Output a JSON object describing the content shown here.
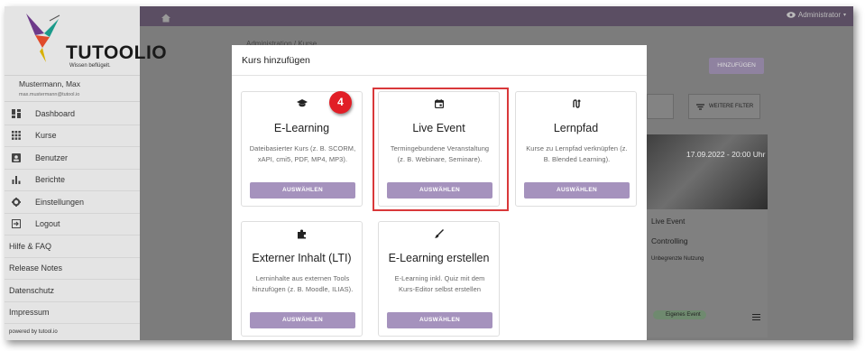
{
  "app": {
    "logo_text": "TUTOOLIO",
    "logo_tagline": "Wissen beflügelt."
  },
  "user": {
    "name": "Mustermann, Max",
    "email": "max.mustermann@tutool.io"
  },
  "sidebar": {
    "items": [
      {
        "label": "Dashboard",
        "icon": "dashboard-icon"
      },
      {
        "label": "Kurse",
        "icon": "grid-icon"
      },
      {
        "label": "Benutzer",
        "icon": "user-icon"
      },
      {
        "label": "Berichte",
        "icon": "bar-chart-icon"
      },
      {
        "label": "Einstellungen",
        "icon": "gear-icon"
      },
      {
        "label": "Logout",
        "icon": "logout-icon"
      }
    ],
    "links": [
      "Hilfe & FAQ",
      "Release Notes",
      "Datenschutz",
      "Impressum"
    ],
    "powered_by": "powered by tutool.io"
  },
  "topbar": {
    "home_icon": "home-icon",
    "admin_label": "Administrator"
  },
  "background": {
    "breadcrumb": "Administration / Kurse",
    "add_button": "HINZUFÜGEN",
    "filter_button": "WEITERE FILTER",
    "course_date": "17.09.2022 - 20:00 Uhr",
    "course_kind": "Live Event",
    "course_title": "Controlling",
    "course_usage": "Unbegrenzte Nutzung",
    "course_badge": "Eigenes Event"
  },
  "modal": {
    "title": "Kurs hinzufügen",
    "cards": [
      {
        "title": "E-Learning",
        "description": "Dateibasierter Kurs (z. B. SCORM, xAPI, cmi5, PDF, MP4, MP3).",
        "button": "AUSWÄHLEN",
        "icon": "graduation-cap-icon"
      },
      {
        "title": "Live Event",
        "description": "Termingebundene Veranstaltung (z. B. Webinare, Seminare).",
        "button": "AUSWÄHLEN",
        "icon": "calendar-icon"
      },
      {
        "title": "Lernpfad",
        "description": "Kurse zu Lernpfad verknüpfen (z. B. Blended Learning).",
        "button": "AUSWÄHLEN",
        "icon": "route-icon"
      },
      {
        "title": "Externer Inhalt (LTI)",
        "description": "Lerninhalte aus externen Tools hinzufügen (z. B. Moodle, ILIAS).",
        "button": "AUSWÄHLEN",
        "icon": "puzzle-icon"
      },
      {
        "title": "E-Learning erstellen",
        "description": "E-Learning inkl. Quiz mit dem Kurs-Editor selbst erstellen",
        "button": "AUSWÄHLEN",
        "icon": "brush-icon"
      }
    ]
  },
  "annotation": {
    "step_number": "4",
    "highlight_color": "#d9383a"
  },
  "colors": {
    "accent": "#a592bd",
    "topbar": "#5b4e63",
    "step_badge": "#e11e26"
  }
}
